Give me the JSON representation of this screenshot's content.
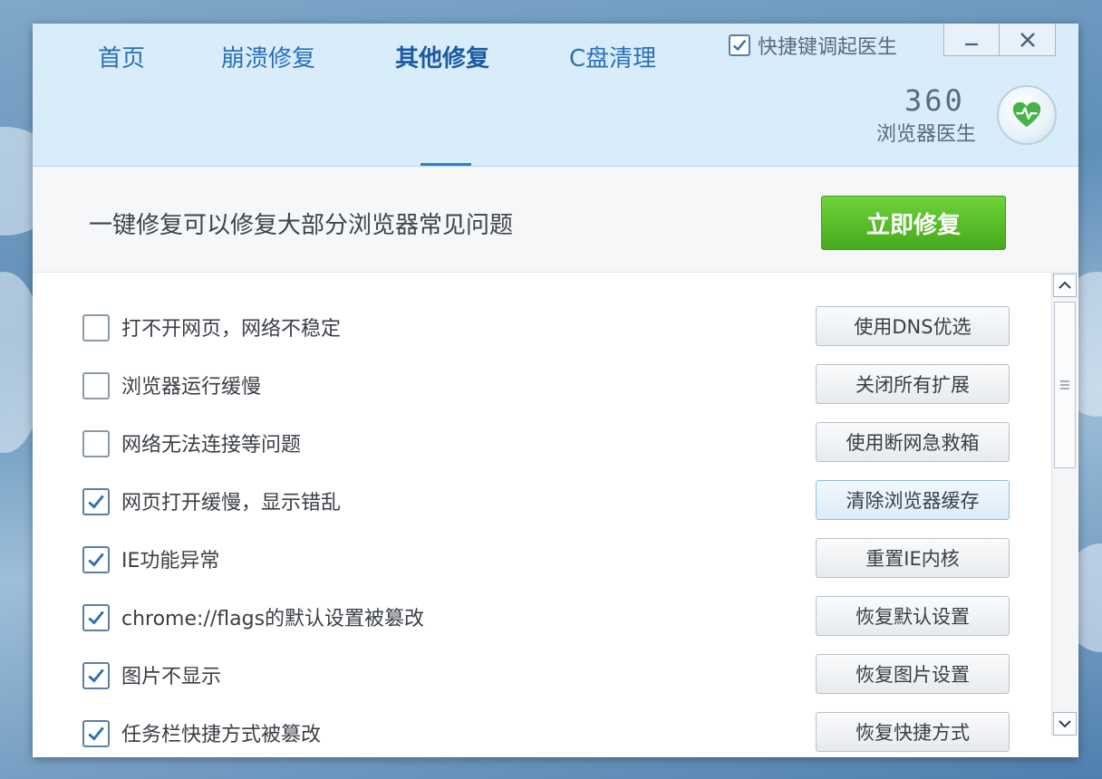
{
  "window": {
    "hotkey_label": "快捷键调起医生",
    "hotkey_checked": true,
    "minimize_icon": "minimize-icon",
    "close_icon": "close-icon"
  },
  "tabs": [
    {
      "label": "首页",
      "active": false
    },
    {
      "label": "崩溃修复",
      "active": false
    },
    {
      "label": "其他修复",
      "active": true
    },
    {
      "label": "C盘清理",
      "active": false
    }
  ],
  "brand": {
    "name": "360",
    "subtitle": "浏览器医生",
    "logo_icon": "heart-pulse-icon"
  },
  "banner": {
    "text": "一键修复可以修复大部分浏览器常见问题",
    "button_label": "立即修复"
  },
  "items": [
    {
      "label": "打不开网页，网络不稳定",
      "checked": false,
      "button": "使用DNS优选"
    },
    {
      "label": "浏览器运行缓慢",
      "checked": false,
      "button": "关闭所有扩展"
    },
    {
      "label": "网络无法连接等问题",
      "checked": false,
      "button": "使用断网急救箱"
    },
    {
      "label": "网页打开缓慢，显示错乱",
      "checked": true,
      "button": "清除浏览器缓存"
    },
    {
      "label": "IE功能异常",
      "checked": true,
      "button": "重置IE内核"
    },
    {
      "label": "chrome://flags的默认设置被篡改",
      "checked": true,
      "button": "恢复默认设置"
    },
    {
      "label": "图片不显示",
      "checked": true,
      "button": "恢复图片设置"
    },
    {
      "label": "任务栏快捷方式被篡改",
      "checked": true,
      "button": "恢复快捷方式"
    }
  ],
  "colors": {
    "accent": "#2a70b8",
    "header_bg": "#d9ecfa",
    "repair_green": "#45a91d"
  }
}
